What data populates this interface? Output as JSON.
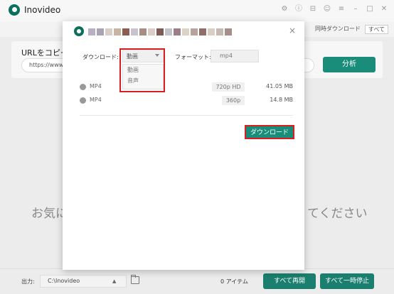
{
  "app": {
    "title": "Inovideo"
  },
  "subbar": {
    "right_text": "同時ダウンロード",
    "right_select": "すべて"
  },
  "url_panel": {
    "label": "URLをコピー",
    "input_value": "https://www.",
    "analyze_label": "分析"
  },
  "background_hint": {
    "left": "お気に",
    "right": "てください"
  },
  "bottom_bar": {
    "output_label": "出力:",
    "output_path": "C:\\Inovideo",
    "items_count": "0 アイテム",
    "resume_all_label": "すべて再開",
    "pause_all_label": "すべて一時停止"
  },
  "modal": {
    "close_glyph": "×",
    "download_label": "ダウンロード:",
    "download_type_value": "動画",
    "download_type_options": [
      "動画",
      "音声"
    ],
    "format_label": "フォーマット:",
    "format_value": "mp4",
    "rows": [
      {
        "format": "MP4",
        "quality": "720p HD",
        "size": "41.05 MB"
      },
      {
        "format": "MP4",
        "quality": "360p",
        "size": "14.8 MB"
      }
    ],
    "download_button_label": "ダウンロード"
  },
  "colors": {
    "accent": "#1a8c7a",
    "highlight_frame": "#d62020",
    "title_pixels": [
      "#b9b0c4",
      "#a9a3b5",
      "#d7cfc5",
      "#c7b4a3",
      "#8b5d52",
      "#c9c3cd",
      "#a78e84",
      "#dacfc8",
      "#7f5a55",
      "#c3c4cb",
      "#9a7f86",
      "#dcd3c7",
      "#b5a39c",
      "#8e6e67",
      "#d9cec3",
      "#c6b9b3",
      "#a68e89"
    ]
  }
}
